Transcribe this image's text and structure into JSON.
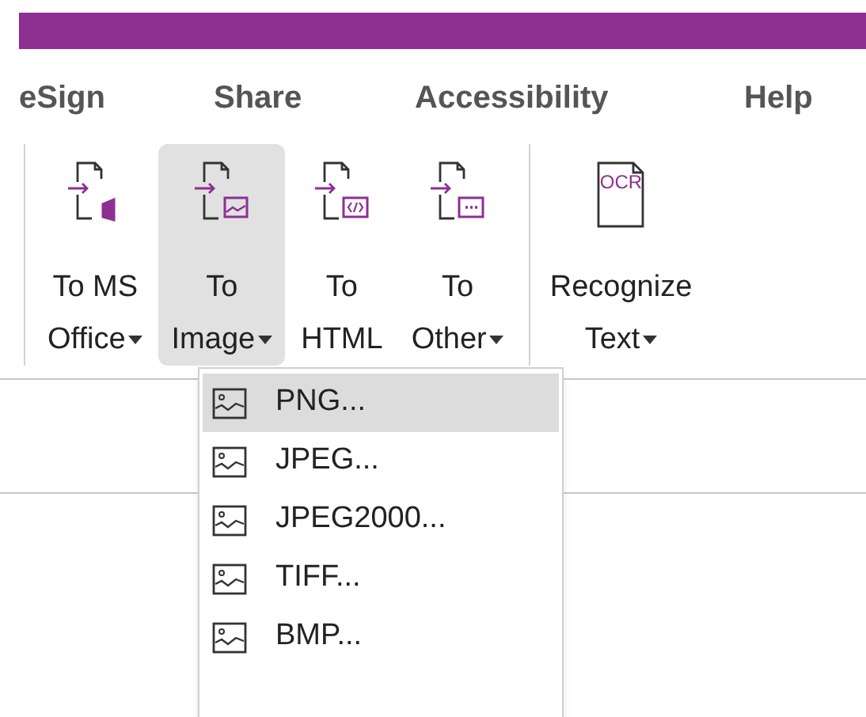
{
  "tabs": [
    {
      "label": "eSign"
    },
    {
      "label": "Share"
    },
    {
      "label": "Accessibility"
    },
    {
      "label": "Help"
    }
  ],
  "ribbon": {
    "groups": [
      [
        {
          "kind": "office",
          "line1": "To MS",
          "line2": "Office",
          "dropdown": true,
          "selected": false
        },
        {
          "kind": "image",
          "line1": "To",
          "line2": "Image",
          "dropdown": true,
          "selected": true
        },
        {
          "kind": "html",
          "line1": "To",
          "line2": "HTML",
          "dropdown": false,
          "selected": false
        },
        {
          "kind": "other",
          "line1": "To",
          "line2": "Other",
          "dropdown": true,
          "selected": false
        }
      ],
      [
        {
          "kind": "ocr",
          "icon_text": "OCR",
          "line1": "Recognize",
          "line2": "Text",
          "dropdown": true,
          "selected": false
        }
      ]
    ]
  },
  "menu": {
    "items": [
      {
        "label": "PNG...",
        "selected": true
      },
      {
        "label": "JPEG...",
        "selected": false
      },
      {
        "label": "JPEG2000...",
        "selected": false
      },
      {
        "label": "TIFF...",
        "selected": false
      },
      {
        "label": "BMP...",
        "selected": false
      }
    ]
  }
}
